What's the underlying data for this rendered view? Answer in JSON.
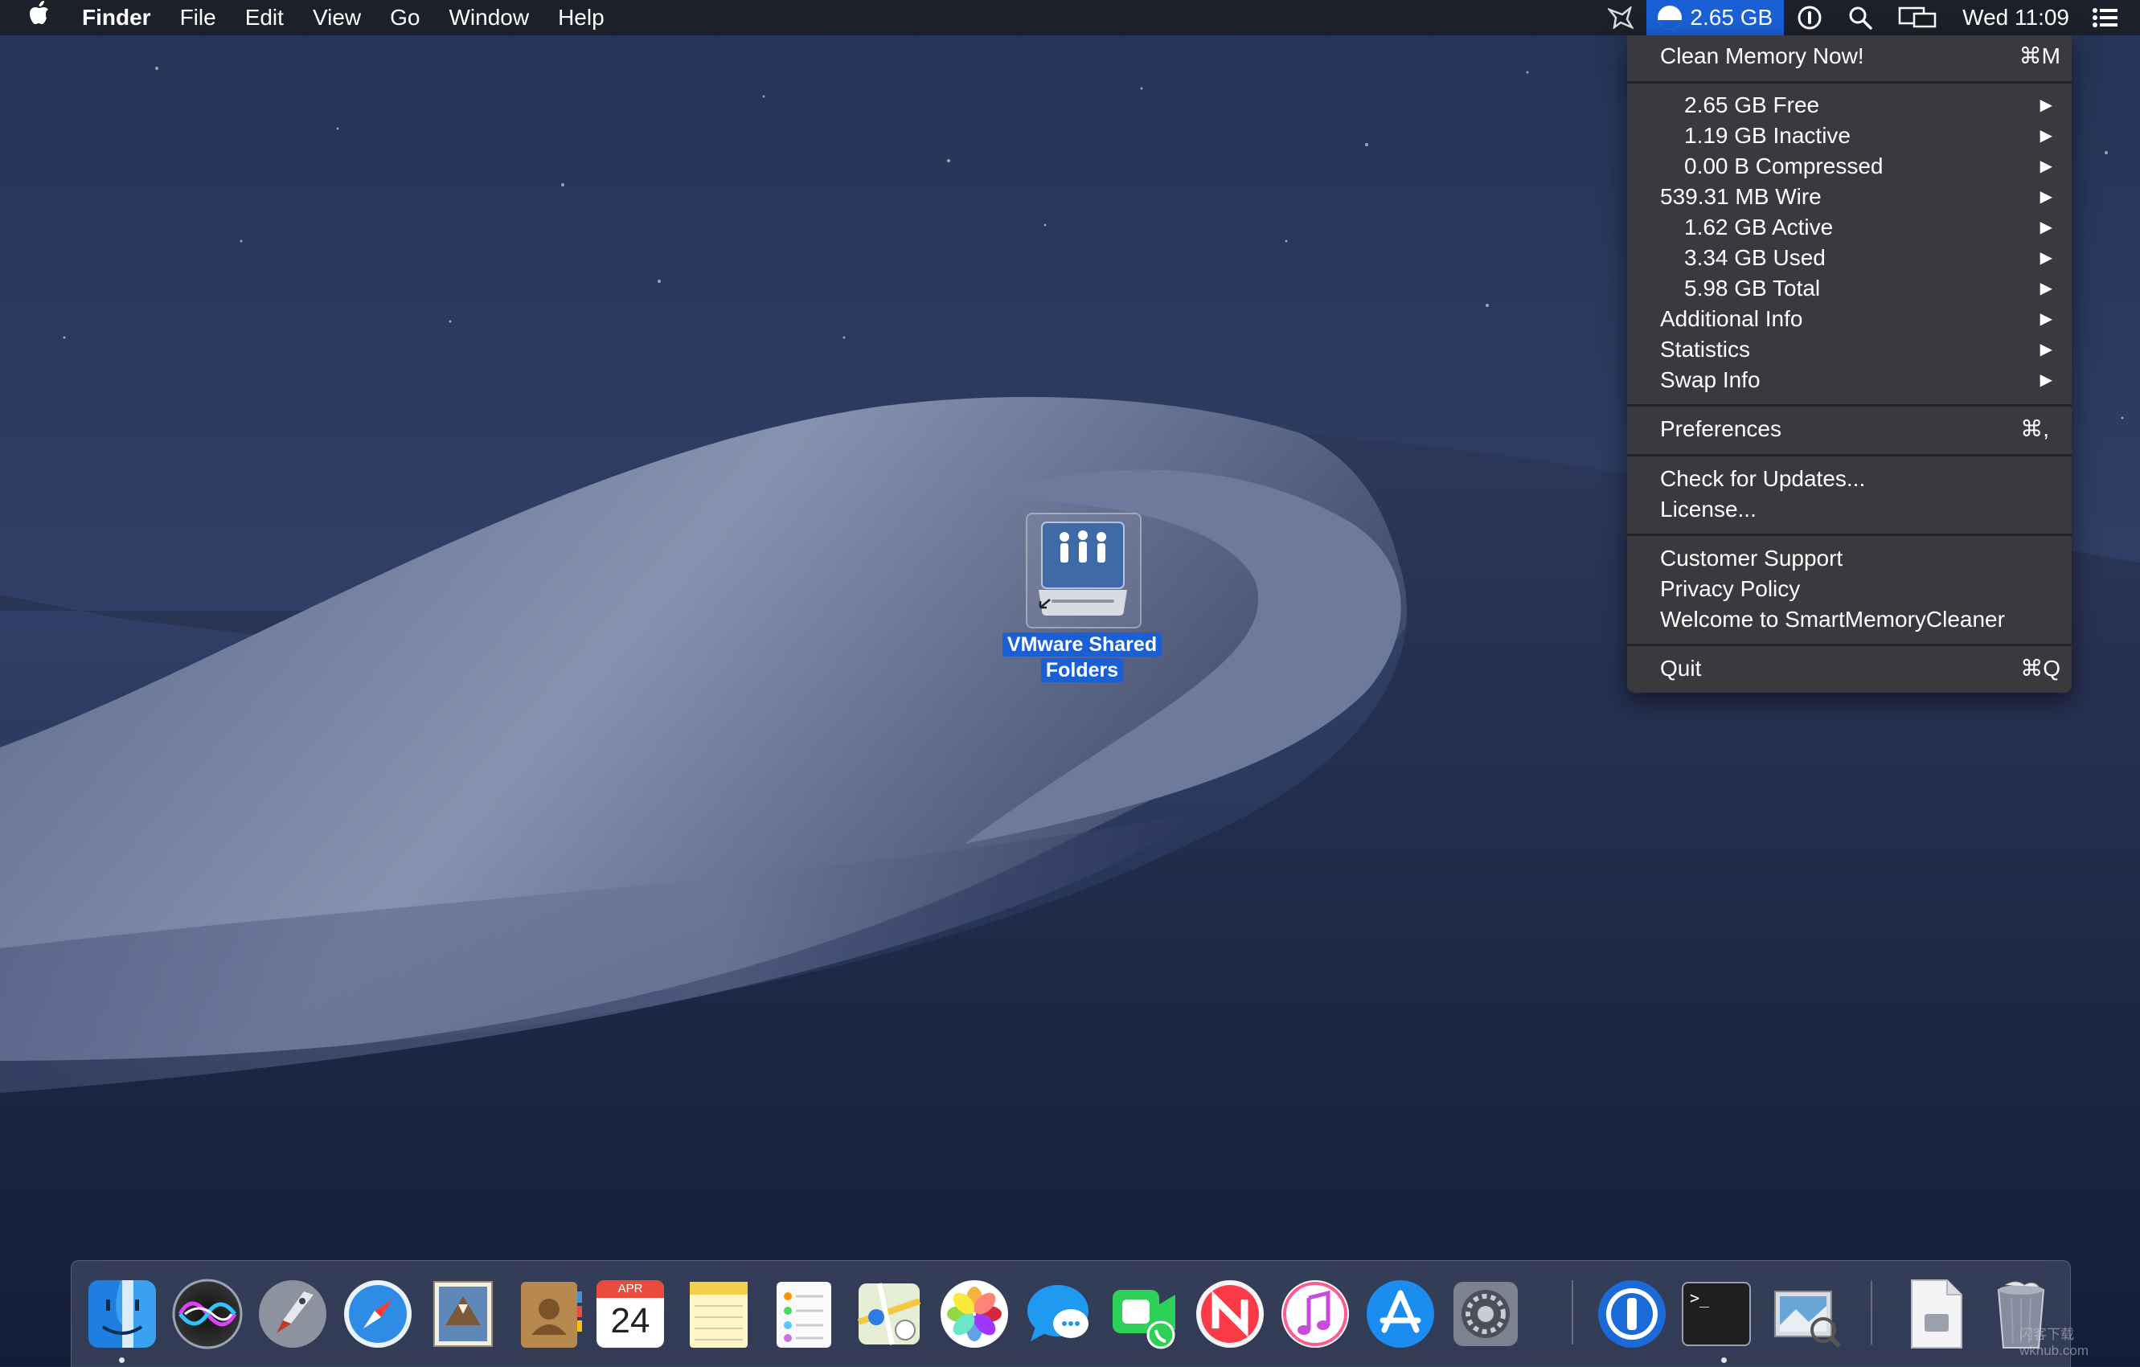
{
  "menubar": {
    "app_name": "Finder",
    "menus": [
      "File",
      "Edit",
      "View",
      "Go",
      "Window",
      "Help"
    ],
    "memory_status": "2.65 GB",
    "clock": "Wed 11:09",
    "icons": [
      "apple-icon",
      "cast-icon",
      "memory-cleaner-icon",
      "one-password-icon",
      "spotlight-search-icon",
      "display-mirroring-icon",
      "notification-center-icon"
    ]
  },
  "memory_menu": {
    "clean_now": "Clean Memory Now!",
    "clean_now_shortcut": "⌘M",
    "stats": [
      {
        "label": "2.65 GB Free",
        "indent": true
      },
      {
        "label": "1.19 GB Inactive",
        "indent": true
      },
      {
        "label": "0.00 B Compressed",
        "indent": true
      },
      {
        "label": "539.31 MB Wire",
        "indent": false
      },
      {
        "label": "1.62 GB Active",
        "indent": true
      },
      {
        "label": "3.34 GB Used",
        "indent": true
      },
      {
        "label": "5.98 GB Total",
        "indent": true
      },
      {
        "label": "Additional Info",
        "indent": false
      },
      {
        "label": "Statistics",
        "indent": false
      },
      {
        "label": "Swap Info",
        "indent": false
      }
    ],
    "preferences": "Preferences",
    "preferences_shortcut": "⌘,",
    "check_updates": "Check for Updates...",
    "license": "License...",
    "customer_support": "Customer Support",
    "privacy_policy": "Privacy Policy",
    "welcome": "Welcome to SmartMemoryCleaner",
    "quit": "Quit",
    "quit_shortcut": "⌘Q"
  },
  "desktop": {
    "icon_label_line1": "VMware Shared",
    "icon_label_line2": "Folders"
  },
  "dock": {
    "calendar_month": "APR",
    "calendar_day": "24",
    "terminal_prompt": ">_",
    "apps": [
      "finder",
      "siri",
      "launchpad",
      "safari",
      "mail",
      "contacts",
      "calendar",
      "notes",
      "reminders",
      "maps",
      "photos",
      "messages",
      "facetime",
      "news",
      "itunes",
      "app-store",
      "system-preferences",
      "one-password",
      "terminal",
      "preview",
      "document",
      "trash"
    ]
  },
  "colors": {
    "accent": "#1a5fd6",
    "menu_bg": "#3a3a3e"
  },
  "watermark": "闪客下载 wkhub.com"
}
